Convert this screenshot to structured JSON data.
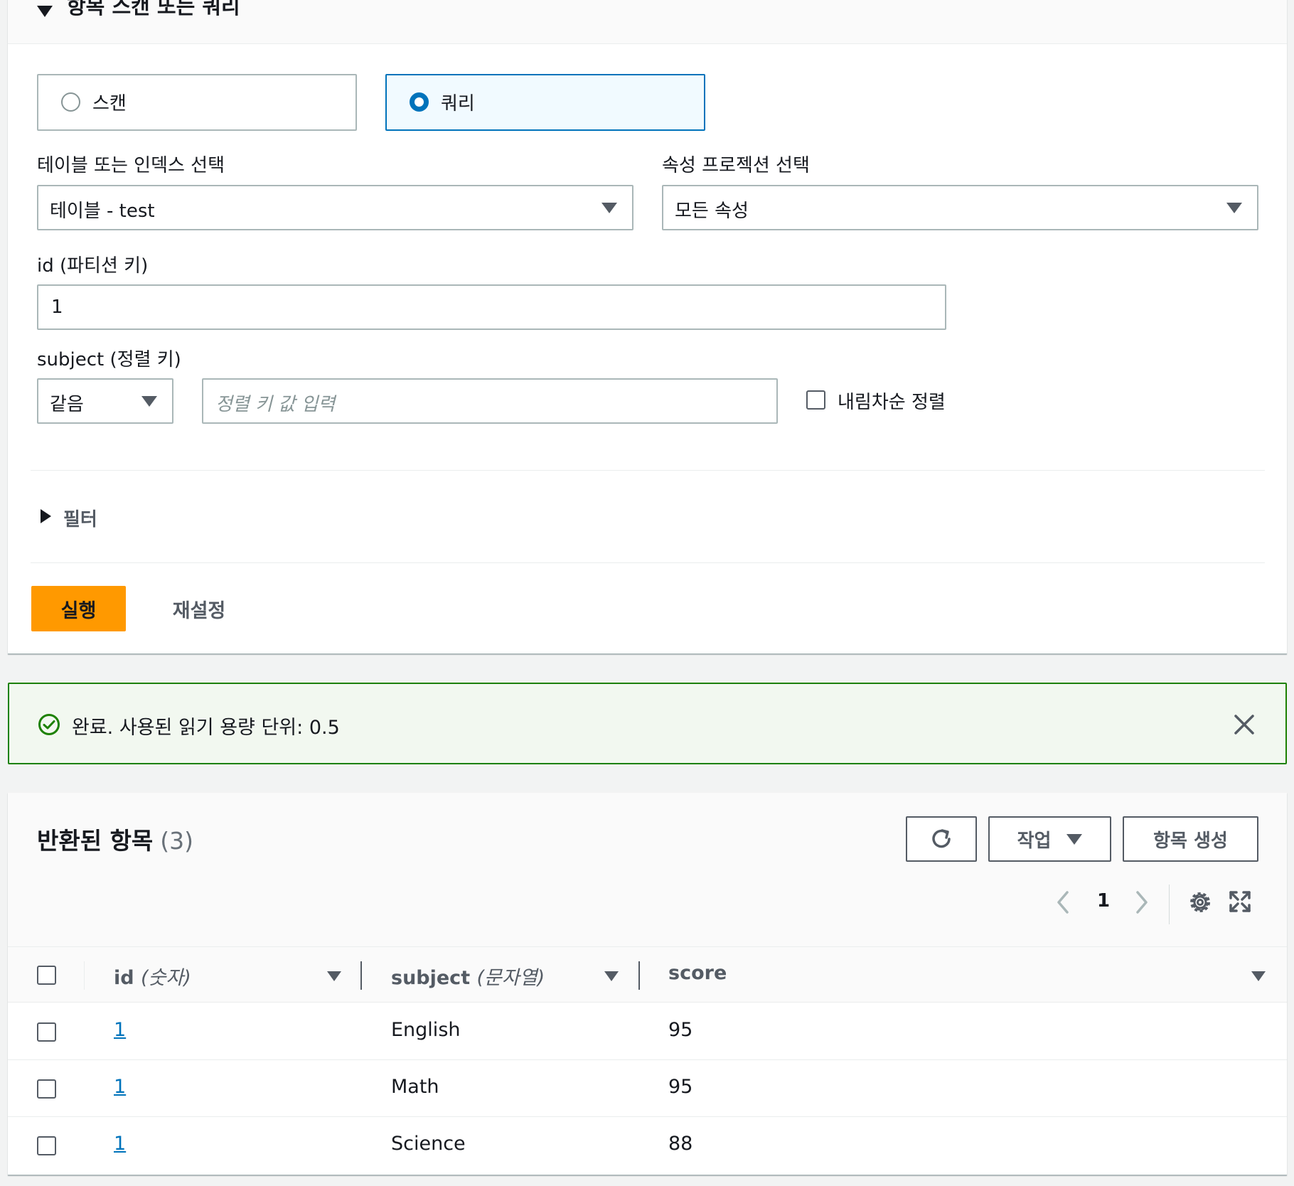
{
  "query_section": {
    "title": "항목 스캔 또는 쿼리",
    "scan_label": "스캔",
    "query_label": "쿼리",
    "selected_mode": "쿼리",
    "table_label": "테이블 또는 인덱스 선택",
    "table_value": "테이블 - test",
    "projection_label": "속성 프로젝션 선택",
    "projection_value": "모든 속성",
    "partition_label": "id (파티션 키)",
    "partition_value": "1",
    "sort_label": "subject (정렬 키)",
    "sort_operator": "같음",
    "sort_placeholder": "정렬 키 값 입력",
    "descending_label": "내림차순 정렬",
    "descending_checked": false,
    "filter_label": "필터",
    "run_label": "실행",
    "reset_label": "재설정"
  },
  "alert": {
    "message": "완료. 사용된 읽기 용량 단위: 0.5",
    "status_color": "#1d8102"
  },
  "results": {
    "title": "반환된 항목",
    "count": "(3)",
    "actions_label": "작업",
    "create_label": "항목 생성",
    "current_page": "1",
    "columns": [
      {
        "name": "id",
        "type": "(숫자)"
      },
      {
        "name": "subject",
        "type": "(문자열)"
      },
      {
        "name": "score",
        "type": ""
      }
    ],
    "rows": [
      {
        "id": "1",
        "subject": "English",
        "score": "95"
      },
      {
        "id": "1",
        "subject": "Math",
        "score": "95"
      },
      {
        "id": "1",
        "subject": "Science",
        "score": "88"
      }
    ]
  },
  "colors": {
    "primary_button": "#ff9900",
    "accent": "#0073bb",
    "success": "#1d8102"
  }
}
